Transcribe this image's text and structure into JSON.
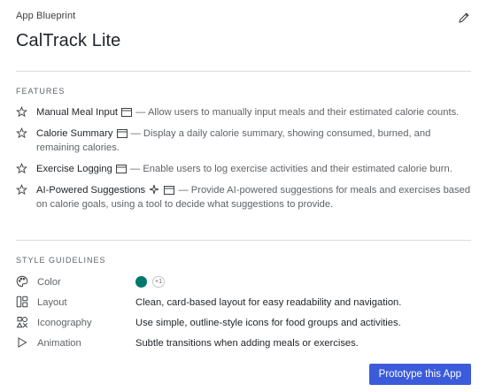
{
  "header": {
    "eyebrow": "App Blueprint",
    "title": "CalTrack Lite",
    "edit_icon": "pencil-icon"
  },
  "features": {
    "label": "FEATURES",
    "items": [
      {
        "name": "Manual Meal Input",
        "description": " — Allow users to manually input meals and their estimated calorie counts.",
        "icons": [
          "star-icon",
          "window-icon"
        ]
      },
      {
        "name": "Calorie Summary",
        "description": " — Display a daily calorie summary, showing consumed, burned, and remaining calories.",
        "icons": [
          "star-icon",
          "window-icon"
        ]
      },
      {
        "name": "Exercise Logging",
        "description": " — Enable users to log exercise activities and their estimated calorie burn.",
        "icons": [
          "star-icon",
          "window-icon"
        ]
      },
      {
        "name": "AI-Powered Suggestions",
        "description": " — Provide AI-powered suggestions for meals and exercises based on calorie goals, using a tool to decide what suggestions to provide.",
        "icons": [
          "star-icon",
          "sparkle-icon",
          "window-icon"
        ]
      }
    ]
  },
  "style_guidelines": {
    "label": "STYLE GUIDELINES",
    "color": {
      "name": "Color",
      "swatch": "#00796b",
      "extra_badge": "+1",
      "icon": "palette-icon"
    },
    "layout": {
      "name": "Layout",
      "value": "Clean, card-based layout for easy readability and navigation.",
      "icon": "layout-icon"
    },
    "iconography": {
      "name": "Iconography",
      "value": "Use simple, outline-style icons for food groups and activities.",
      "icon": "shapes-icon"
    },
    "animation": {
      "name": "Animation",
      "value": "Subtle transitions when adding meals or exercises.",
      "icon": "play-icon"
    }
  },
  "actions": {
    "prototype_label": "Prototype this App",
    "accent": "#3b5bdb"
  }
}
